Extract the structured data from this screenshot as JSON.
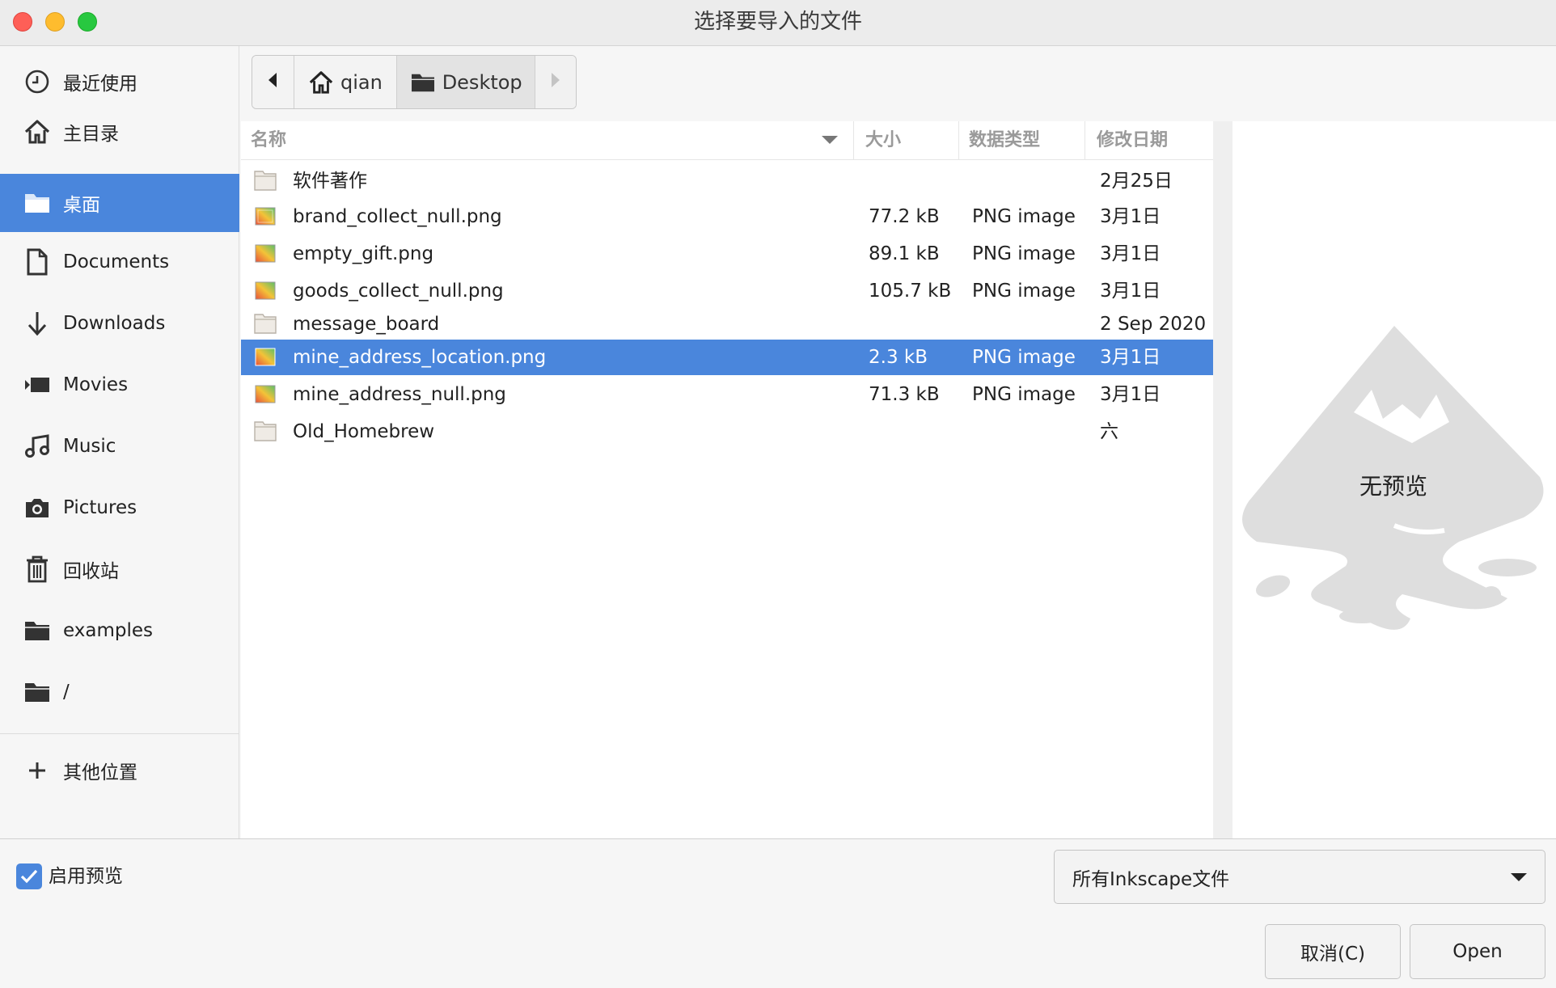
{
  "window": {
    "title": "选择要导入的文件"
  },
  "sidebar": {
    "items": [
      {
        "label": "最近使用",
        "icon": "clock-icon"
      },
      {
        "label": "主目录",
        "icon": "home-icon"
      },
      {
        "label": "桌面",
        "icon": "folder-icon",
        "active": true
      },
      {
        "label": "Documents",
        "icon": "document-icon"
      },
      {
        "label": "Downloads",
        "icon": "download-arrow-icon"
      },
      {
        "label": "Movies",
        "icon": "movie-icon"
      },
      {
        "label": "Music",
        "icon": "music-note-icon"
      },
      {
        "label": "Pictures",
        "icon": "camera-icon"
      },
      {
        "label": "回收站",
        "icon": "trash-icon"
      },
      {
        "label": "examples",
        "icon": "folder-icon"
      },
      {
        "label": "/",
        "icon": "folder-icon"
      }
    ],
    "other_locations": {
      "label": "其他位置",
      "icon": "plus-icon"
    }
  },
  "pathbar": {
    "home_label": "qian",
    "current_label": "Desktop"
  },
  "filelist": {
    "headers": {
      "name": "名称",
      "size": "大小",
      "type": "数据类型",
      "modified": "修改日期"
    },
    "rows": [
      {
        "name": "软件著作",
        "size": "",
        "type": "",
        "modified": "2月25日",
        "kind": "folder"
      },
      {
        "name": "brand_collect_null.png",
        "size": "77.2 kB",
        "type": "PNG image",
        "modified": "3月1日",
        "kind": "image"
      },
      {
        "name": "empty_gift.png",
        "size": "89.1 kB",
        "type": "PNG image",
        "modified": "3月1日",
        "kind": "image"
      },
      {
        "name": "goods_collect_null.png",
        "size": "105.7 kB",
        "type": "PNG image",
        "modified": "3月1日",
        "kind": "image"
      },
      {
        "name": "message_board",
        "size": "",
        "type": "",
        "modified": "2 Sep 2020",
        "kind": "folder"
      },
      {
        "name": "mine_address_location.png",
        "size": "2.3 kB",
        "type": "PNG image",
        "modified": "3月1日",
        "kind": "image",
        "selected": true
      },
      {
        "name": "mine_address_null.png",
        "size": "71.3 kB",
        "type": "PNG image",
        "modified": "3月1日",
        "kind": "image"
      },
      {
        "name": "Old_Homebrew",
        "size": "",
        "type": "",
        "modified": "六",
        "kind": "folder"
      }
    ]
  },
  "preview": {
    "label": "无预览"
  },
  "footer": {
    "enable_preview_label": "启用预览",
    "enable_preview_checked": true,
    "filter_selected": "所有Inkscape文件",
    "cancel_label": "取消(C)",
    "open_label": "Open"
  },
  "colors": {
    "accent": "#4a86dc"
  }
}
